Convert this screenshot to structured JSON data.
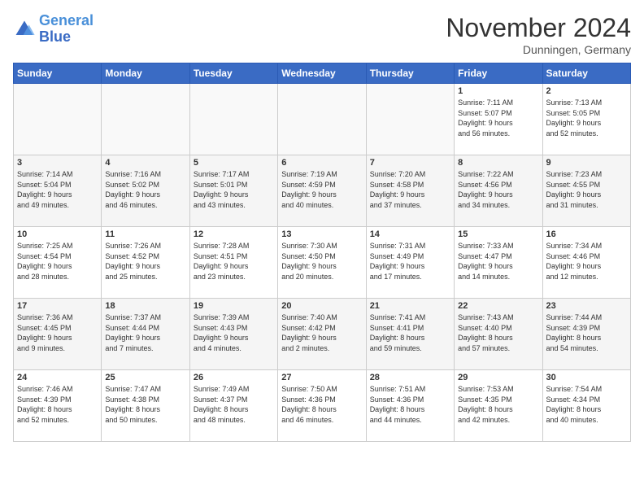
{
  "header": {
    "logo_line1": "General",
    "logo_line2": "Blue",
    "month_title": "November 2024",
    "location": "Dunningen, Germany"
  },
  "weekdays": [
    "Sunday",
    "Monday",
    "Tuesday",
    "Wednesday",
    "Thursday",
    "Friday",
    "Saturday"
  ],
  "weeks": [
    [
      {
        "day": "",
        "info": ""
      },
      {
        "day": "",
        "info": ""
      },
      {
        "day": "",
        "info": ""
      },
      {
        "day": "",
        "info": ""
      },
      {
        "day": "",
        "info": ""
      },
      {
        "day": "1",
        "info": "Sunrise: 7:11 AM\nSunset: 5:07 PM\nDaylight: 9 hours\nand 56 minutes."
      },
      {
        "day": "2",
        "info": "Sunrise: 7:13 AM\nSunset: 5:05 PM\nDaylight: 9 hours\nand 52 minutes."
      }
    ],
    [
      {
        "day": "3",
        "info": "Sunrise: 7:14 AM\nSunset: 5:04 PM\nDaylight: 9 hours\nand 49 minutes."
      },
      {
        "day": "4",
        "info": "Sunrise: 7:16 AM\nSunset: 5:02 PM\nDaylight: 9 hours\nand 46 minutes."
      },
      {
        "day": "5",
        "info": "Sunrise: 7:17 AM\nSunset: 5:01 PM\nDaylight: 9 hours\nand 43 minutes."
      },
      {
        "day": "6",
        "info": "Sunrise: 7:19 AM\nSunset: 4:59 PM\nDaylight: 9 hours\nand 40 minutes."
      },
      {
        "day": "7",
        "info": "Sunrise: 7:20 AM\nSunset: 4:58 PM\nDaylight: 9 hours\nand 37 minutes."
      },
      {
        "day": "8",
        "info": "Sunrise: 7:22 AM\nSunset: 4:56 PM\nDaylight: 9 hours\nand 34 minutes."
      },
      {
        "day": "9",
        "info": "Sunrise: 7:23 AM\nSunset: 4:55 PM\nDaylight: 9 hours\nand 31 minutes."
      }
    ],
    [
      {
        "day": "10",
        "info": "Sunrise: 7:25 AM\nSunset: 4:54 PM\nDaylight: 9 hours\nand 28 minutes."
      },
      {
        "day": "11",
        "info": "Sunrise: 7:26 AM\nSunset: 4:52 PM\nDaylight: 9 hours\nand 25 minutes."
      },
      {
        "day": "12",
        "info": "Sunrise: 7:28 AM\nSunset: 4:51 PM\nDaylight: 9 hours\nand 23 minutes."
      },
      {
        "day": "13",
        "info": "Sunrise: 7:30 AM\nSunset: 4:50 PM\nDaylight: 9 hours\nand 20 minutes."
      },
      {
        "day": "14",
        "info": "Sunrise: 7:31 AM\nSunset: 4:49 PM\nDaylight: 9 hours\nand 17 minutes."
      },
      {
        "day": "15",
        "info": "Sunrise: 7:33 AM\nSunset: 4:47 PM\nDaylight: 9 hours\nand 14 minutes."
      },
      {
        "day": "16",
        "info": "Sunrise: 7:34 AM\nSunset: 4:46 PM\nDaylight: 9 hours\nand 12 minutes."
      }
    ],
    [
      {
        "day": "17",
        "info": "Sunrise: 7:36 AM\nSunset: 4:45 PM\nDaylight: 9 hours\nand 9 minutes."
      },
      {
        "day": "18",
        "info": "Sunrise: 7:37 AM\nSunset: 4:44 PM\nDaylight: 9 hours\nand 7 minutes."
      },
      {
        "day": "19",
        "info": "Sunrise: 7:39 AM\nSunset: 4:43 PM\nDaylight: 9 hours\nand 4 minutes."
      },
      {
        "day": "20",
        "info": "Sunrise: 7:40 AM\nSunset: 4:42 PM\nDaylight: 9 hours\nand 2 minutes."
      },
      {
        "day": "21",
        "info": "Sunrise: 7:41 AM\nSunset: 4:41 PM\nDaylight: 8 hours\nand 59 minutes."
      },
      {
        "day": "22",
        "info": "Sunrise: 7:43 AM\nSunset: 4:40 PM\nDaylight: 8 hours\nand 57 minutes."
      },
      {
        "day": "23",
        "info": "Sunrise: 7:44 AM\nSunset: 4:39 PM\nDaylight: 8 hours\nand 54 minutes."
      }
    ],
    [
      {
        "day": "24",
        "info": "Sunrise: 7:46 AM\nSunset: 4:39 PM\nDaylight: 8 hours\nand 52 minutes."
      },
      {
        "day": "25",
        "info": "Sunrise: 7:47 AM\nSunset: 4:38 PM\nDaylight: 8 hours\nand 50 minutes."
      },
      {
        "day": "26",
        "info": "Sunrise: 7:49 AM\nSunset: 4:37 PM\nDaylight: 8 hours\nand 48 minutes."
      },
      {
        "day": "27",
        "info": "Sunrise: 7:50 AM\nSunset: 4:36 PM\nDaylight: 8 hours\nand 46 minutes."
      },
      {
        "day": "28",
        "info": "Sunrise: 7:51 AM\nSunset: 4:36 PM\nDaylight: 8 hours\nand 44 minutes."
      },
      {
        "day": "29",
        "info": "Sunrise: 7:53 AM\nSunset: 4:35 PM\nDaylight: 8 hours\nand 42 minutes."
      },
      {
        "day": "30",
        "info": "Sunrise: 7:54 AM\nSunset: 4:34 PM\nDaylight: 8 hours\nand 40 minutes."
      }
    ]
  ]
}
